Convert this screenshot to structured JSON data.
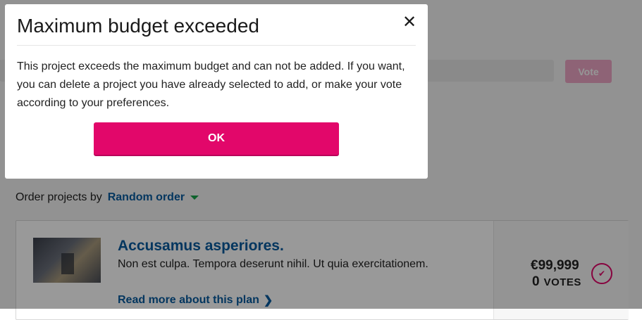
{
  "modal": {
    "title": "Maximum budget exceeded",
    "close_icon": "close-icon",
    "body": "This project exceeds the maximum budget and can not be added. If you want, you can delete a project you have already selected to add, or make your vote according to your preferences.",
    "ok_label": "OK"
  },
  "toolbar": {
    "vote_label": "Vote"
  },
  "order": {
    "label": "Order projects by",
    "selected": "Random order"
  },
  "project": {
    "title": "Accusamus asperiores.",
    "description": "Non est culpa. Tempora deserunt nihil. Ut quia exercitationem.",
    "read_more": "Read more about this plan",
    "price": "€99,999",
    "votes_count": "0",
    "votes_label": "VOTES"
  },
  "colors": {
    "accent": "#e2076a",
    "link": "#075b9e",
    "caret": "#18a44a"
  }
}
